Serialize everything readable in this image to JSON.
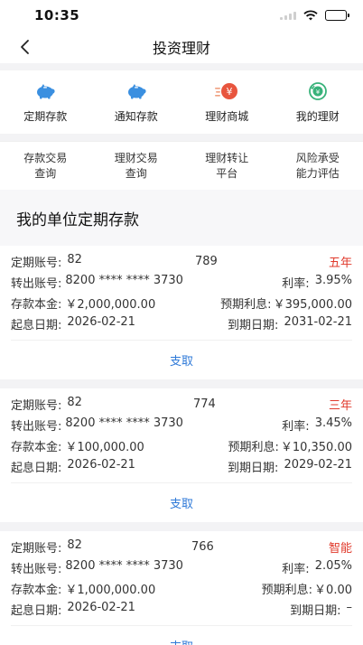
{
  "status": {
    "time": "10:35"
  },
  "nav": {
    "title": "投资理财"
  },
  "menu": [
    {
      "label": "定期存款",
      "icon": "piggy-bank-icon"
    },
    {
      "label": "通知存款",
      "icon": "piggy-bank-icon"
    },
    {
      "label": "理财商城",
      "icon": "yen-coin-icon"
    },
    {
      "label": "我的理财",
      "icon": "my-finance-icon"
    }
  ],
  "functions": [
    {
      "label": "存款交易\n查询"
    },
    {
      "label": "理财交易\n查询"
    },
    {
      "label": "理财转让\n平台"
    },
    {
      "label": "风险承受\n能力评估"
    }
  ],
  "section": {
    "title": "我的单位定期存款"
  },
  "colors": {
    "accent_red": "#e0392b",
    "link_blue": "#2f7ad8"
  },
  "deposits": [
    {
      "account_label": "定期账号:",
      "account_prefix": "82",
      "account_suffix": "789",
      "term": "五年",
      "from_label": "转出账号:",
      "from_account": "8200 **** **** 3730",
      "rate_label": "利率:",
      "rate": "3.95%",
      "principal_label": "存款本金:",
      "principal": "￥2,000,000.00",
      "interest_label": "预期利息:",
      "interest": "￥395,000.00",
      "start_label": "起息日期:",
      "start_date": "2026-02-21",
      "end_label": "到期日期:",
      "end_date": "2031-02-21",
      "withdraw": "支取"
    },
    {
      "account_label": "定期账号:",
      "account_prefix": "82",
      "account_suffix": "774",
      "term": "三年",
      "from_label": "转出账号:",
      "from_account": "8200 **** **** 3730",
      "rate_label": "利率:",
      "rate": "3.45%",
      "principal_label": "存款本金:",
      "principal": "￥100,000.00",
      "interest_label": "预期利息:",
      "interest": "￥10,350.00",
      "start_label": "起息日期:",
      "start_date": "2026-02-21",
      "end_label": "到期日期:",
      "end_date": "2029-02-21",
      "withdraw": "支取"
    },
    {
      "account_label": "定期账号:",
      "account_prefix": "82",
      "account_suffix": "766",
      "term": "智能",
      "from_label": "转出账号:",
      "from_account": "8200 **** **** 3730",
      "rate_label": "利率:",
      "rate": "2.05%",
      "principal_label": "存款本金:",
      "principal": "￥1,000,000.00",
      "interest_label": "预期利息:",
      "interest": "￥0.00",
      "start_label": "起息日期:",
      "start_date": "2026-02-21",
      "end_label": "到期日期:",
      "end_date": "–",
      "withdraw": "支取"
    }
  ]
}
